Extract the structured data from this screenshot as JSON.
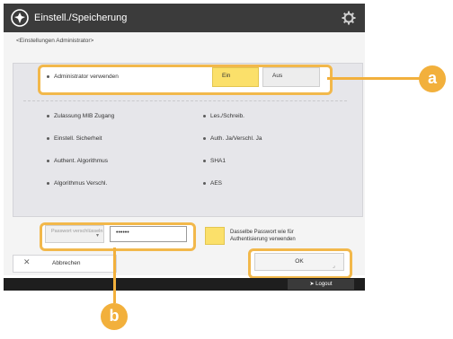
{
  "window": {
    "title": "Einstell./Speicherung"
  },
  "breadcrumb": "<Einstellungen Administrator>",
  "settings": {
    "use_admin": {
      "label": "Administrator verwenden",
      "on_label": "Ein",
      "off_label": "Aus",
      "selected": "Ein"
    },
    "left_column": [
      {
        "label": "Zulassung MIB Zugang"
      },
      {
        "label": "Einstell. Sicherheit"
      },
      {
        "label": "Authent. Algorithmus"
      },
      {
        "label": "Algorithmus Verschl."
      }
    ],
    "right_column": [
      {
        "label": "Les./Schreib."
      },
      {
        "label": "Auth. Ja/Verschl. Ja"
      },
      {
        "label": "SHA1"
      },
      {
        "label": "AES"
      }
    ],
    "password": {
      "select_placeholder": "Passwort verschlüsseln",
      "value": "••••••",
      "same_password_label": "Dasselbe Passwort wie für Authentisierung verwenden"
    }
  },
  "footer": {
    "cancel_label": "Abbrechen",
    "ok_label": "OK",
    "logout_label": "Logout"
  },
  "markers": {
    "a": "a",
    "b": "b"
  },
  "colors": {
    "titlebar": "#3b3b3b",
    "highlight": "#f2b84b",
    "selected_button": "#fbe06a",
    "marker": "#f2b03c"
  }
}
